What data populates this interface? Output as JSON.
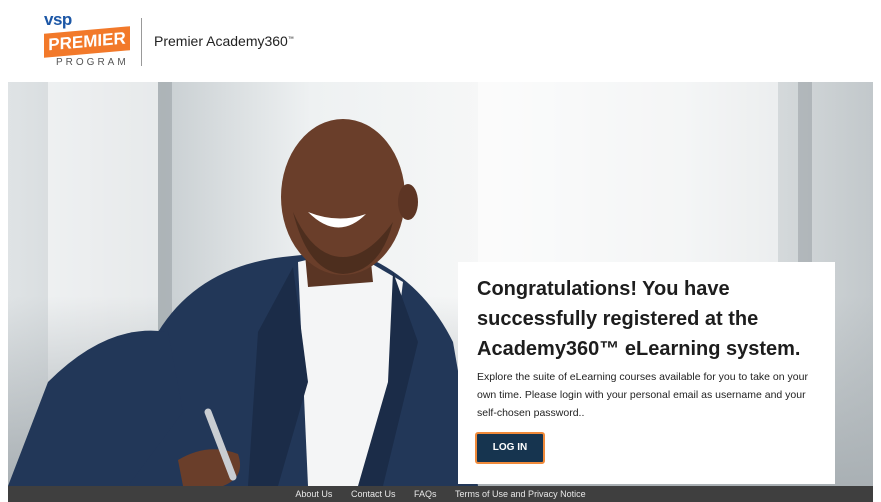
{
  "header": {
    "logo": {
      "line1": "vsp",
      "line2": "PREMIER",
      "line3": "PROGRAM"
    },
    "brand_title": "Premier Academy360"
  },
  "hero": {
    "image": "smiling-man-in-suit-photo"
  },
  "card": {
    "title": "Congratulations! You have successfully registered at the Academy360™ eLearning system.",
    "body": "Explore the suite of eLearning courses available for you to take on your own time. Please login with your personal email as username and your self-chosen password..",
    "login_label": "LOG IN"
  },
  "footer": {
    "links": [
      "About Us",
      "Contact Us",
      "FAQs",
      "Terms of Use and Privacy Notice"
    ]
  },
  "colors": {
    "brand_orange": "#f2792a",
    "brand_blue": "#1c57a6",
    "button_navy": "#16344f",
    "button_border": "#f08a3a",
    "footer_bg": "#3f3f3f"
  }
}
